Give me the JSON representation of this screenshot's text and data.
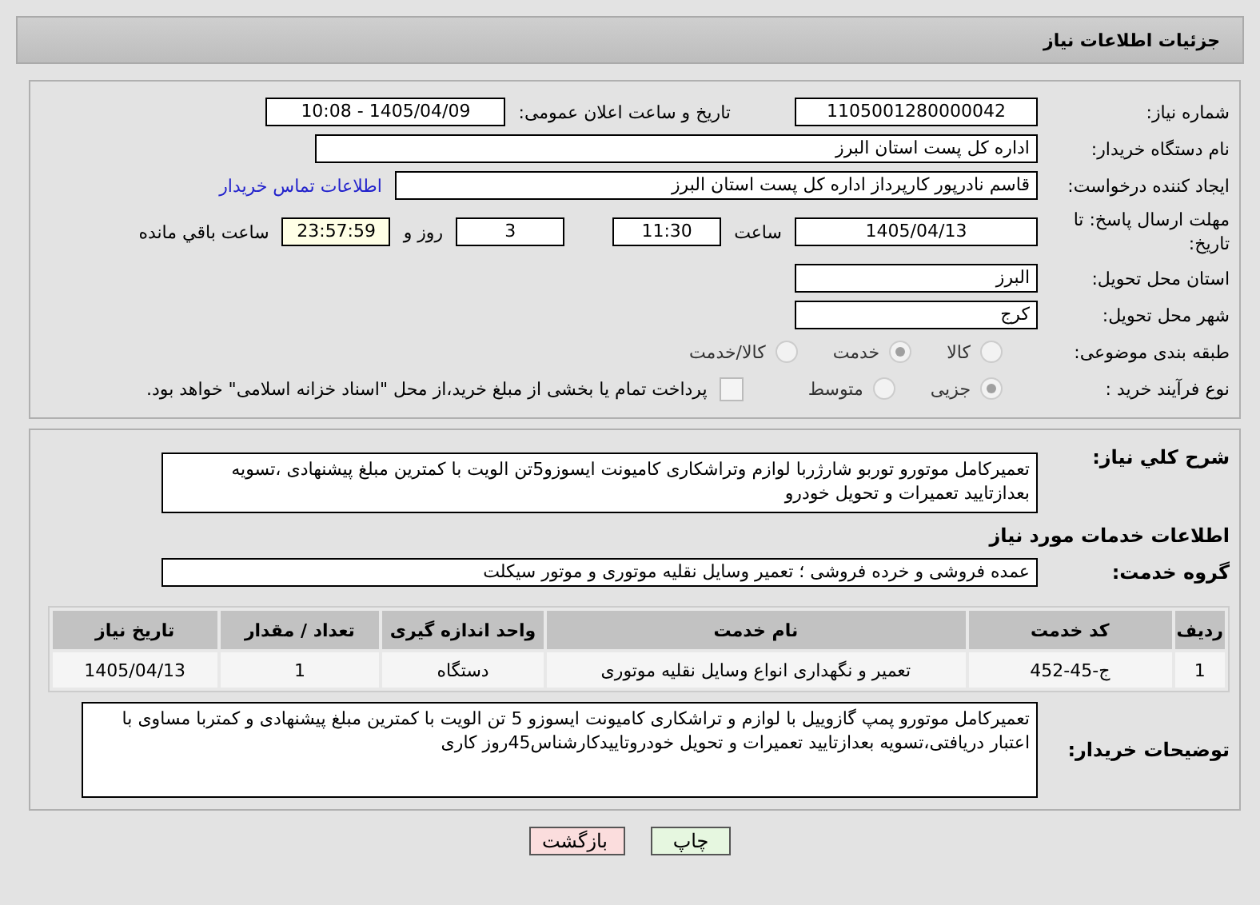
{
  "header": {
    "title": "جزئیات اطلاعات نیاز"
  },
  "need_number": {
    "label": "شماره نیاز:",
    "value": "1105001280000042"
  },
  "announce": {
    "label": "تاریخ و ساعت اعلان عمومی:",
    "value": "1405/04/09 - 10:08"
  },
  "buyer_org": {
    "label": "نام دستگاه خریدار:",
    "value": "اداره کل پست استان البرز"
  },
  "requester": {
    "label": "ایجاد کننده درخواست:",
    "value": "قاسم نادرپور کارپرداز اداره کل پست استان البرز",
    "link": "اطلاعات تماس خریدار"
  },
  "deadline": {
    "label": "مهلت ارسال پاسخ: تا تاریخ:",
    "date": "1405/04/13",
    "time_label": "ساعت",
    "time": "11:30",
    "days": "3",
    "days_label": "روز و",
    "remaining": "23:57:59",
    "remaining_label": "ساعت باقي مانده"
  },
  "province": {
    "label": "استان محل تحویل:",
    "value": "البرز"
  },
  "city": {
    "label": "شهر محل تحویل:",
    "value": "کرج"
  },
  "category": {
    "label": "طبقه بندی موضوعی:",
    "options": [
      {
        "label": "کالا",
        "selected": false
      },
      {
        "label": "خدمت",
        "selected": true
      },
      {
        "label": "کالا/خدمت",
        "selected": false
      }
    ]
  },
  "process": {
    "label": "نوع فرآیند خرید :",
    "options": [
      {
        "label": "جزیی",
        "selected": true
      },
      {
        "label": "متوسط",
        "selected": false
      }
    ],
    "treasury": {
      "checked": false,
      "label": "پرداخت تمام یا بخشی از مبلغ خرید،از محل \"اسناد خزانه اسلامی\" خواهد بود."
    }
  },
  "description": {
    "label": "شرح کلي نیاز:",
    "value": "تعمیرکامل موتورو توربو شارژربا لوازم وتراشکاری کامیونت ایسوزو5تن الویت با کمترین مبلغ پیشنهادی ،تسویه بعدازتایید تعمیرات و تحویل خودرو"
  },
  "services_heading": "اطلاعات خدمات مورد نیاز",
  "service_group": {
    "label": "گروه خدمت:",
    "value": "عمده فروشی و خرده فروشی ؛ تعمیر وسایل نقلیه موتوری و موتور سیکلت"
  },
  "table": {
    "columns": [
      "ردیف",
      "کد خدمت",
      "نام خدمت",
      "واحد اندازه گیری",
      "تعداد / مقدار",
      "تاریخ نیاز"
    ],
    "rows": [
      [
        "1",
        "ج-45-452",
        "تعمیر و نگهداری انواع وسایل نقلیه موتوری",
        "دستگاه",
        "1",
        "1405/04/13"
      ]
    ]
  },
  "buyer_notes": {
    "label": "توضیحات خریدار:",
    "value": "تعمیرکامل موتورو پمپ گازوییل با لوازم و تراشکاری کامیونت ایسوزو 5 تن الویت با کمترین مبلغ پیشنهادی و کمتربا مساوی با اعتبار دریافتی،تسویه بعدازتایید تعمیرات و تحویل خودروتاییدکارشناس45روز کاری"
  },
  "buttons": [
    {
      "label": "چاپ",
      "kind": "print"
    },
    {
      "label": "بازگشت",
      "kind": "back"
    }
  ]
}
